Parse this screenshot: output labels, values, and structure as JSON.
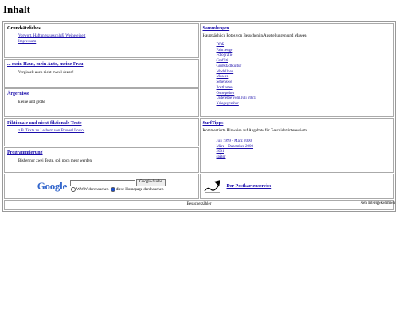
{
  "title": "Inhalt",
  "grundsaetzliches": {
    "heading": "Grundsätzliches",
    "links": [
      "Vorwort, Haftungsausschluß, Weiheleiheit",
      "Impressum"
    ]
  },
  "haus": {
    "heading": "... mein Haus, mein Auto, meine Frau",
    "desc": "Vergisselt auch nicht zwvel dezon!"
  },
  "aergernisse": {
    "heading": "Ärgernisse",
    "desc": "kleine und große"
  },
  "texte": {
    "heading": "Fiktionale und nicht-fiktionale Texte",
    "links": [
      "z.B. Texte zu Lesbern von Brunerl Lowo;"
    ]
  },
  "programmierung": {
    "heading": "Programmierung",
    "desc": "Bisher nur zwei Texte, soll noch mehr werden."
  },
  "sammlungen": {
    "heading": "Sammlungen",
    "desc": "Hauptsächlich Fotos von Besuchen in Ausstellungen und Museen",
    "links": [
      "DDR",
      "Fahrzeuge",
      "Fotografie",
      "Graffiti",
      "Großstadtkultur",
      "Modellbau",
      "Museen",
      "Sehenswe",
      "Postkarten",
      "Ostsepolter",
      "Unterelbe vom Juli 2021",
      "Kriegsgraeber"
    ]
  },
  "surftipps": {
    "heading": "SurfTipps",
    "desc": "Kommentierte Hinweise auf Angebote für Geschichtsinteressierte.",
    "links": [
      "Juli 1999 - März 2000",
      "März - Dezember 2000",
      "2001",
      "später"
    ]
  },
  "google": {
    "logo": "Google",
    "button": "Google-Suche",
    "opt_www": "WWW durchsuchen",
    "opt_site": "diese Homepage durchsuchen"
  },
  "postkarten": {
    "heading": "Der Postkartenservice"
  },
  "footer": "Besucherzähler",
  "note": "Nen Interegekommen"
}
